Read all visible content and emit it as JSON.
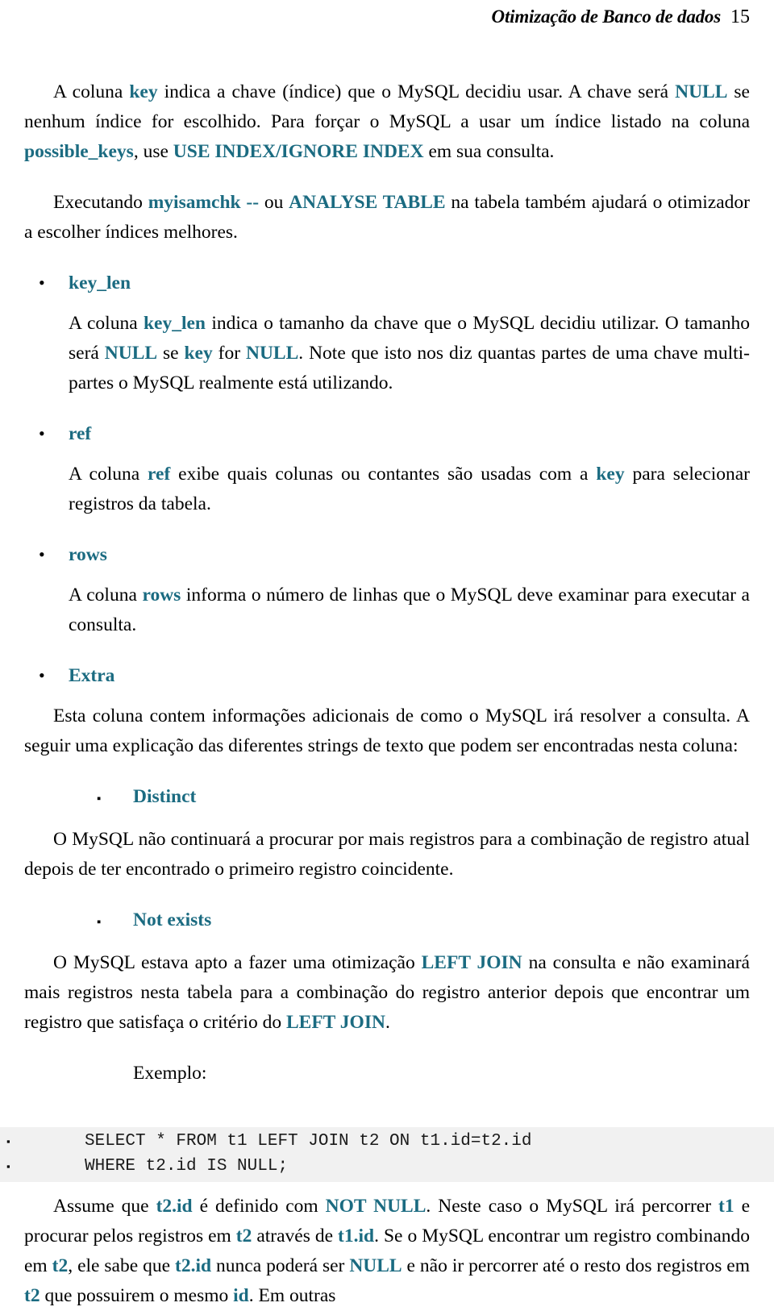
{
  "header": {
    "title": "Otimização de Banco de dados",
    "page_number": "15"
  },
  "paragraphs": {
    "p1_a": "A coluna ",
    "p1_key": "key",
    "p1_b": " indica a chave (índice) que o MySQL decidiu usar. A chave será ",
    "p1_null": "NULL",
    "p1_c": " se nenhum índice for escolhido. Para forçar o MySQL a usar um índice listado na coluna ",
    "p1_possible_keys": "possible_keys",
    "p1_d": ", use ",
    "p1_use_index": "USE INDEX/IGNORE INDEX",
    "p1_e": " em sua consulta.",
    "p2_a": "Executando ",
    "p2_myisamchk": "myisamchk --",
    "p2_b": " ou ",
    "p2_analyse": "ANALYSE TABLE",
    "p2_c": "  na tabela também ajudará o otimizador a escolher índices melhores."
  },
  "bullets": {
    "key_len": {
      "marker": "bullet-dot",
      "label": "key_len",
      "body_a": "A coluna ",
      "body_key_len": "key_len",
      "body_b": " indica o tamanho da chave que o MySQL decidiu utilizar. O tamanho será ",
      "body_null1": "NULL",
      "body_c": " se ",
      "body_key": "key",
      "body_d": " for ",
      "body_null2": "NULL",
      "body_e": ". Note que isto nos diz quantas partes de uma chave multi-partes o MySQL realmente está utilizando."
    },
    "ref": {
      "marker": "bullet-dot",
      "label": "ref",
      "body_a": "A coluna ",
      "body_ref": "ref",
      "body_b": " exibe quais colunas ou contantes são usadas com a ",
      "body_key": "key",
      "body_c": " para selecionar registros da tabela."
    },
    "rows": {
      "marker": "bullet-dot",
      "label": "rows",
      "body_a": "A coluna ",
      "body_rows": "rows",
      "body_b": " informa o número de linhas que o MySQL deve examinar para executar a consulta."
    },
    "extra": {
      "marker": "bullet-dot",
      "label": "Extra",
      "body": "Esta coluna contem informações adicionais de como o MySQL irá resolver a consulta. A seguir uma explicação das diferentes strings de texto que podem ser encontradas nesta coluna:"
    }
  },
  "subbullets": {
    "distinct": {
      "marker": "bullet-square",
      "label": "Distinct",
      "body": "O MySQL não continuará a procurar por mais registros para a combinação de registro atual depois de ter encontrado o primeiro registro coincidente."
    },
    "not_exists": {
      "marker": "bullet-square",
      "label": "Not exists",
      "body_a": "O MySQL estava apto a fazer uma otimização ",
      "body_left_join1": "LEFT JOIN",
      "body_b": " na consulta e não examinará mais registros nesta tabela para a combinação do registro anterior depois que encontrar um registro que satisfaça o critério do ",
      "body_left_join2": "LEFT JOIN",
      "body_c": "."
    }
  },
  "example": {
    "label": "Exemplo:",
    "code_lines": [
      "SELECT * FROM t1 LEFT JOIN t2 ON t1.id=t2.id",
      "WHERE t2.id IS NULL;"
    ],
    "line_markers": [
      "▪",
      "▪"
    ]
  },
  "final_paragraph": {
    "a": "Assume que ",
    "t2id_1": "t2.id",
    "b": " é definido com ",
    "not_null": "NOT NULL",
    "c": ". Neste caso o MySQL irá percorrer ",
    "t1_1": "t1",
    "d": " e procurar pelos registros em ",
    "t2_1": "t2",
    "e": " através de ",
    "t1id": "t1.id",
    "f": ". Se o MySQL encontrar um registro combinando em ",
    "t2_2": "t2",
    "g": ", ele sabe que ",
    "t2id_2": "t2.id",
    "h": " nunca poderá ser ",
    "null": "NULL",
    "i": " e não ir percorrer até o resto dos registros em ",
    "t2_3": "t2",
    "j": " que possuirem o mesmo ",
    "id": "id",
    "k": ". Em outras"
  },
  "colors": {
    "accent_teal": "#1b6b81",
    "code_background": "#f1f1f1",
    "text": "#000000"
  },
  "markers": {
    "bullet-dot": "•",
    "bullet-square": "▪"
  }
}
